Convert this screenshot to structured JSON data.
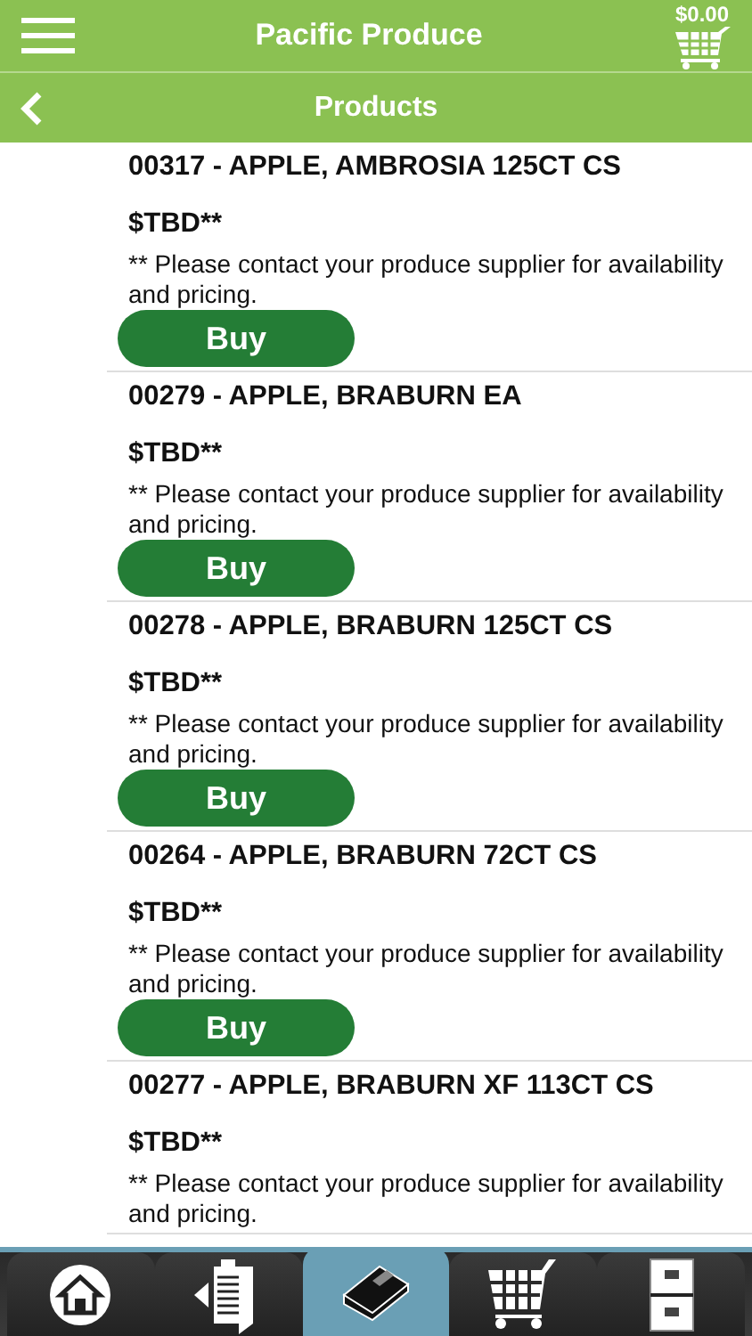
{
  "header": {
    "title": "Pacific Produce",
    "cart_total": "$0.00"
  },
  "subheader": {
    "title": "Products"
  },
  "products": [
    {
      "title": "00317 - APPLE, AMBROSIA 125CT CS",
      "price": "$TBD**",
      "note": "** Please contact your produce supplier for availability and pricing.",
      "button": "Buy"
    },
    {
      "title": "00279 - APPLE, BRABURN EA",
      "price": "$TBD**",
      "note": "** Please contact your produce supplier for availability and pricing.",
      "button": "Buy"
    },
    {
      "title": "00278 - APPLE, BRABURN 125CT CS",
      "price": "$TBD**",
      "note": "** Please contact your produce supplier for availability and pricing.",
      "button": "Buy"
    },
    {
      "title": "00264 - APPLE, BRABURN 72CT CS",
      "price": "$TBD**",
      "note": "** Please contact your produce supplier for availability and pricing.",
      "button": "Buy"
    },
    {
      "title": "00277 - APPLE, BRABURN XF 113CT CS",
      "price": "$TBD**",
      "note": "** Please contact your produce supplier for availability and pricing."
    }
  ],
  "tabs": [
    {
      "kind": "home",
      "selected": false
    },
    {
      "kind": "orders",
      "selected": false
    },
    {
      "kind": "catalog",
      "selected": true
    },
    {
      "kind": "cart",
      "selected": false
    },
    {
      "kind": "cabinet",
      "selected": false
    }
  ]
}
